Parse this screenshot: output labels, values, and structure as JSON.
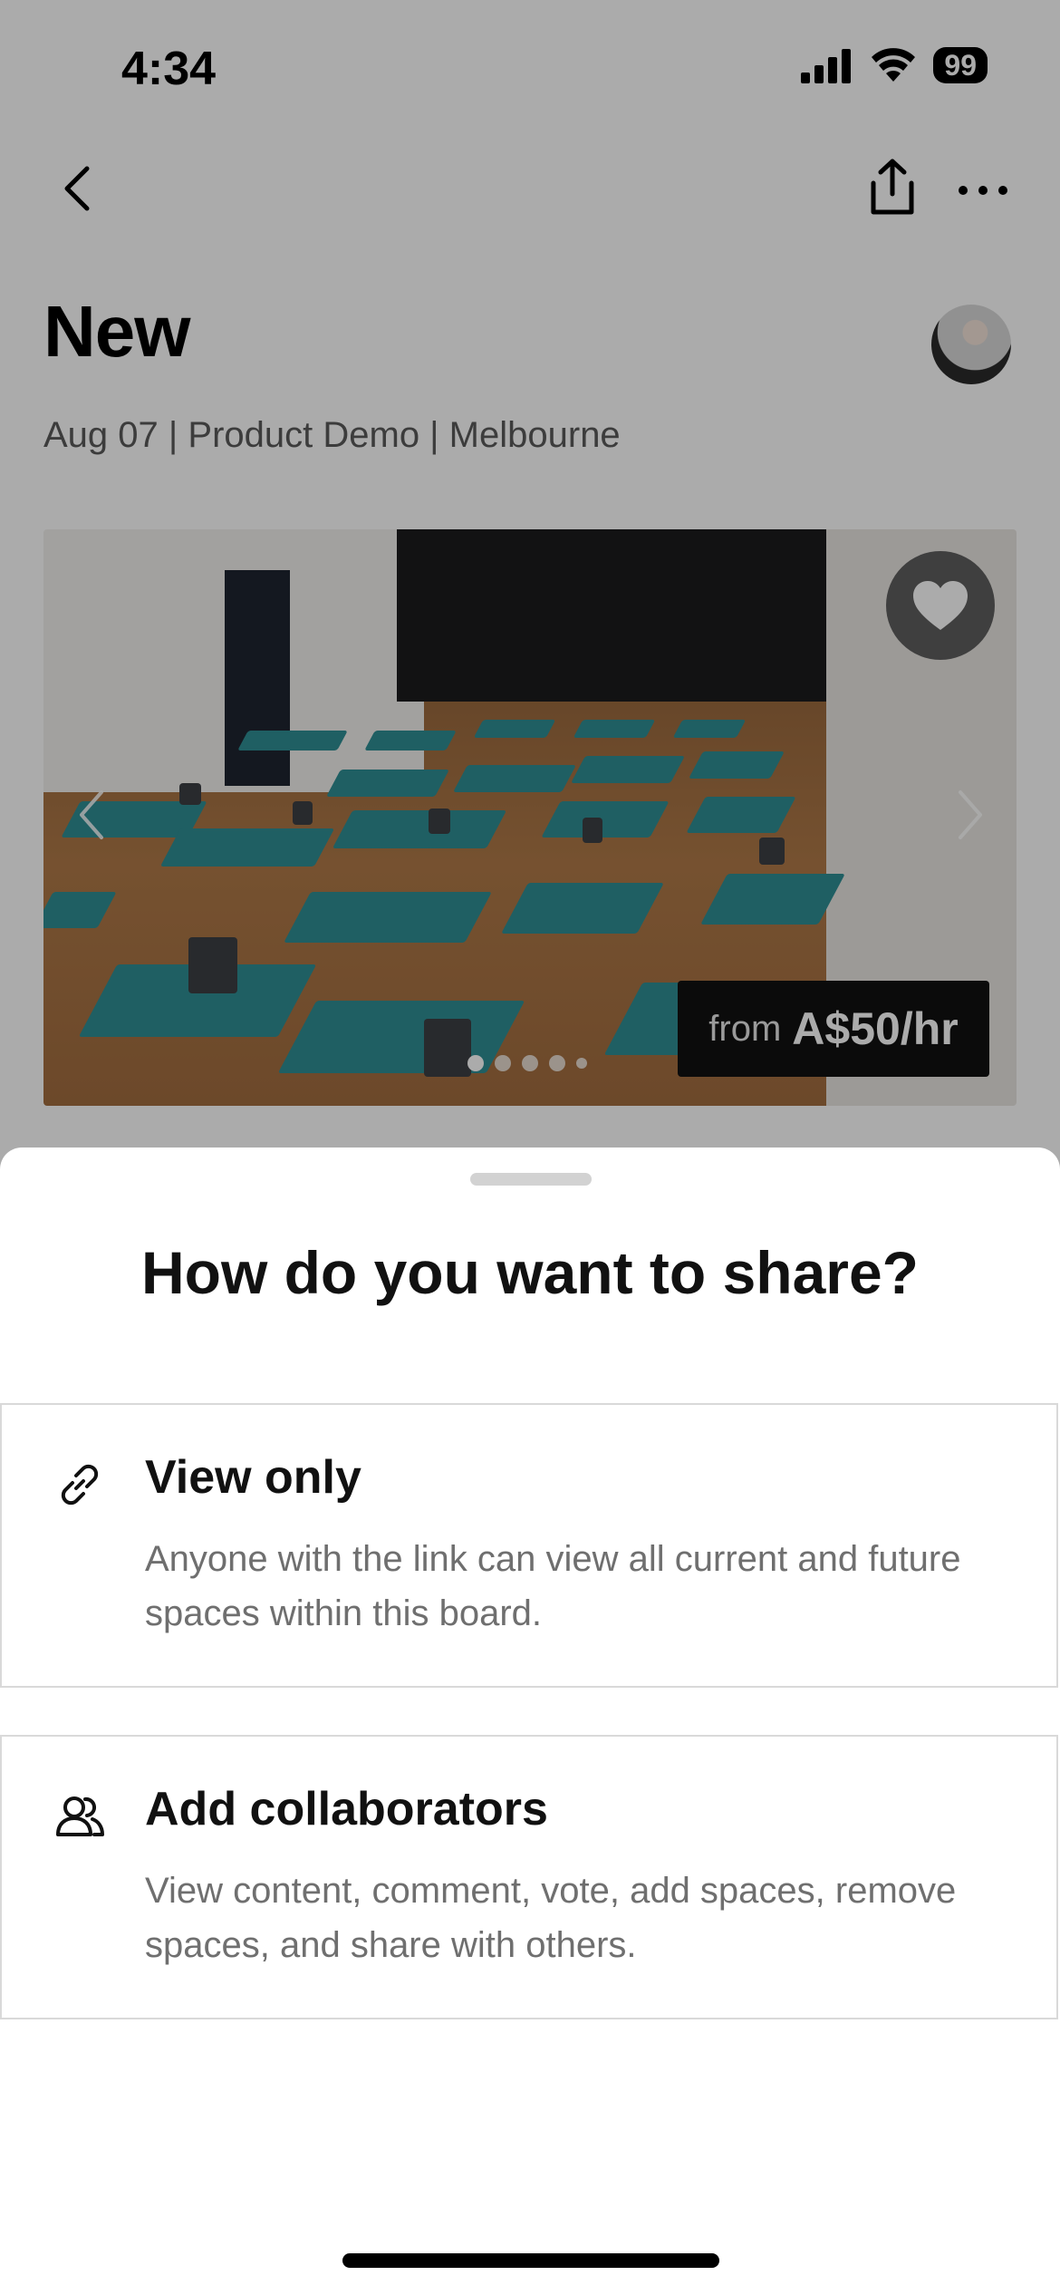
{
  "status_bar": {
    "time": "4:34",
    "battery": "99"
  },
  "header": {
    "title": "New",
    "subtitle": "Aug 07 | Product Demo | Melbourne"
  },
  "listing": {
    "price_prefix": "from",
    "price": "A$50/hr",
    "carousel_dots": 5,
    "active_dot": 1
  },
  "share_sheet": {
    "title": "How do you want to share?",
    "options": [
      {
        "icon": "link-icon",
        "title": "View only",
        "description": "Anyone with the link can view all current and future spaces within this board."
      },
      {
        "icon": "people-icon",
        "title": "Add collaborators",
        "description": "View content, comment, vote, add spaces, remove spaces, and share with others."
      }
    ]
  },
  "colors": {
    "mat_teal": "#2f8e94",
    "overlay": "#000000",
    "text_primary": "#111111",
    "text_secondary": "#6f6f6f"
  }
}
